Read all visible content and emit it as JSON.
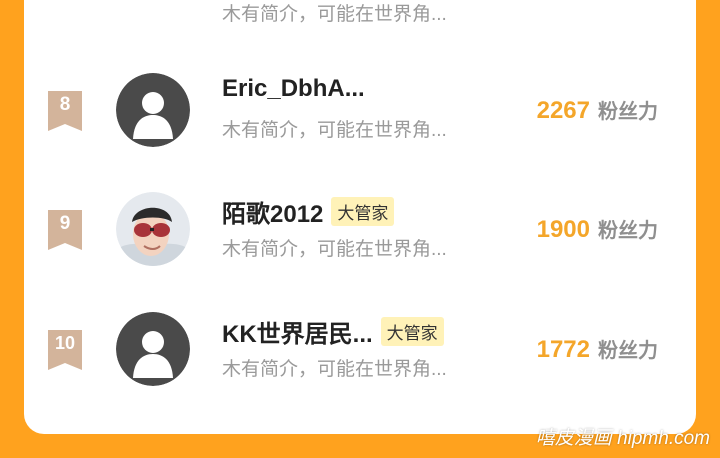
{
  "top_row": {
    "name": "",
    "bio": "木有简介，可能在世界角..."
  },
  "rows": [
    {
      "rank": "8",
      "name": "Eric_DbhA...",
      "badge": "",
      "bio": "木有简介，可能在世界角...",
      "score": "2267",
      "score_label": "粉丝力",
      "avatar": "default-avatar-icon"
    },
    {
      "rank": "9",
      "name": "陌歌2012",
      "badge": "大管家",
      "bio": "木有简介，可能在世界角...",
      "score": "1900",
      "score_label": "粉丝力",
      "avatar": "user-photo"
    },
    {
      "rank": "10",
      "name": "KK世界居民...",
      "badge": "大管家",
      "bio": "木有简介，可能在世界角...",
      "score": "1772",
      "score_label": "粉丝力",
      "avatar": "default-avatar-icon"
    }
  ],
  "watermark": "嘻皮漫画 hipmh.com",
  "colors": {
    "accent": "#f4a62a",
    "page_bg": "#ffa21e",
    "badge_bg": "#fff2b8",
    "rank_badge": "#d3b49b"
  }
}
